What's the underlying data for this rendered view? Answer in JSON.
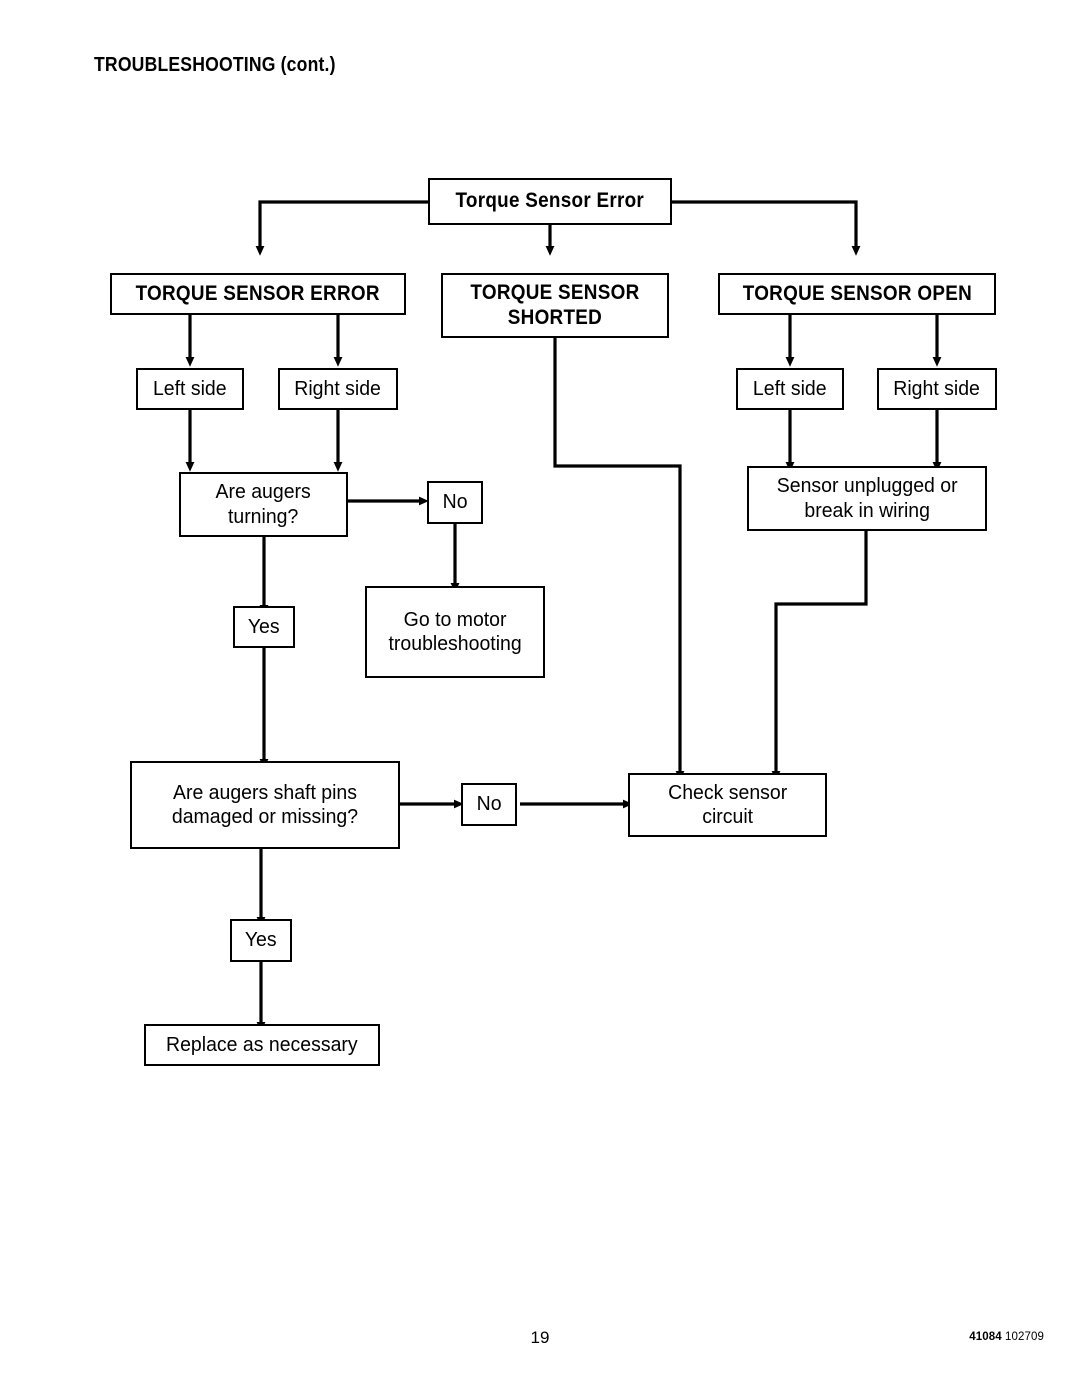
{
  "document": {
    "heading": "TROUBLESHOOTING (cont.)",
    "page_number": "19",
    "footer_code_part": "41084",
    "footer_date_part": "102709",
    "ink_color": "#000000",
    "paper_color": "#ffffff"
  },
  "flowchart": {
    "title": "Torque Sensor Error flow diagram",
    "root": {
      "label": "Torque Sensor Error"
    },
    "branches": {
      "error": {
        "label": "TORQUE SENSOR ERROR"
      },
      "shorted": {
        "label_line1": "TORQUE SENSOR",
        "label_line2": "SHORTED"
      },
      "open": {
        "label": "TORQUE SENSOR OPEN"
      }
    },
    "nodes": {
      "error_left_side": {
        "label": "Left side"
      },
      "error_right_side": {
        "label": "Right side"
      },
      "augers_turning": {
        "label_line1": "Are augers",
        "label_line2": "turning?"
      },
      "augers_turning_no": {
        "label": "No"
      },
      "augers_turning_yes": {
        "label": "Yes"
      },
      "go_to_motor": {
        "label_line1": "Go to motor",
        "label_line2": "troubleshooting"
      },
      "shaft_pins": {
        "label_line1": "Are augers shaft pins",
        "label_line2": "damaged or missing?"
      },
      "shaft_pins_no": {
        "label": "No"
      },
      "shaft_pins_yes": {
        "label": "Yes"
      },
      "replace": {
        "label": "Replace as necessary"
      },
      "open_left_side": {
        "label": "Left side"
      },
      "open_right_side": {
        "label": "Right side"
      },
      "sensor_unplugged": {
        "label_line1": "Sensor unplugged or",
        "label_line2": "break in wiring"
      },
      "check_sensor_circuit": {
        "label_line1": "Check sensor",
        "label_line2": "circuit"
      }
    }
  }
}
